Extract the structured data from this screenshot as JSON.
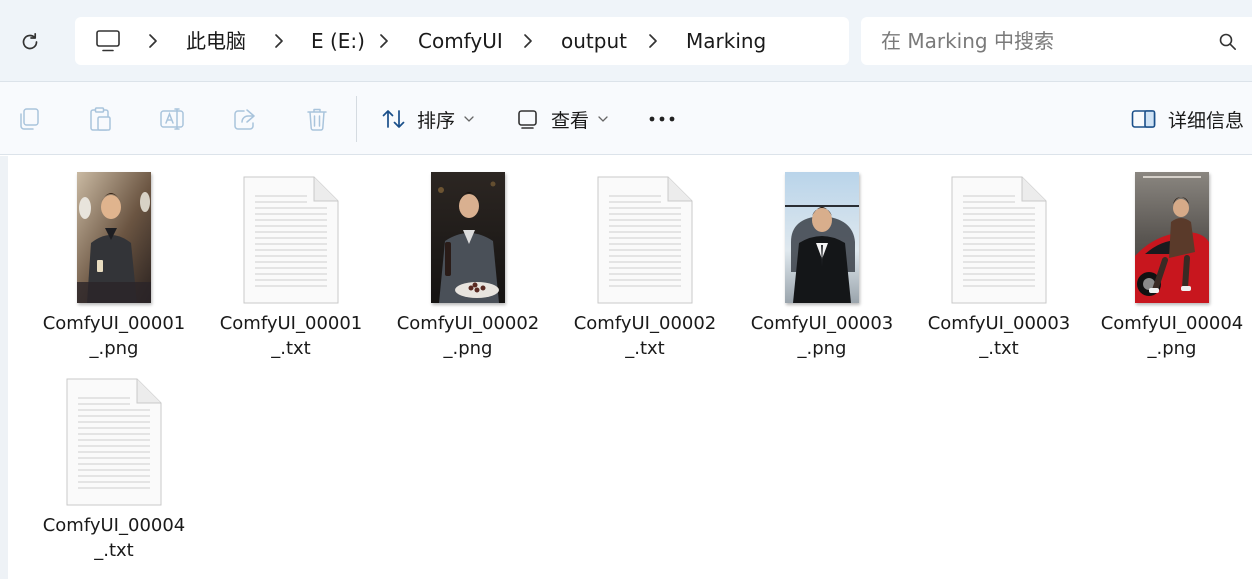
{
  "breadcrumb": {
    "items": [
      "此电脑",
      "E (E:)",
      "ComfyUI",
      "output",
      "Marking"
    ]
  },
  "search": {
    "placeholder": "在 Marking 中搜索"
  },
  "toolbar": {
    "sort_label": "排序",
    "view_label": "查看",
    "details_label": "详细信息"
  },
  "files": [
    {
      "name_line1": "ComfyUI_00001",
      "name_line2": "_.png",
      "type": "png",
      "thumb": "man-in-jet"
    },
    {
      "name_line1": "ComfyUI_00001",
      "name_line2": "_.txt",
      "type": "txt"
    },
    {
      "name_line1": "ComfyUI_00002",
      "name_line2": "_.png",
      "type": "png",
      "thumb": "man-with-wine"
    },
    {
      "name_line1": "ComfyUI_00002",
      "name_line2": "_.txt",
      "type": "txt"
    },
    {
      "name_line1": "ComfyUI_00003",
      "name_line2": "_.png",
      "type": "png",
      "thumb": "man-by-helicopter"
    },
    {
      "name_line1": "ComfyUI_00003",
      "name_line2": "_.txt",
      "type": "txt"
    },
    {
      "name_line1": "ComfyUI_00004",
      "name_line2": "_.png",
      "type": "png",
      "thumb": "man-on-red-car"
    },
    {
      "name_line1": "ComfyUI_00004",
      "name_line2": "_.txt",
      "type": "txt"
    }
  ],
  "colors": {
    "address_bg": "#eff4f9",
    "toolbar_bg": "#f8fafd",
    "accent_blue": "#1a4f8a"
  }
}
